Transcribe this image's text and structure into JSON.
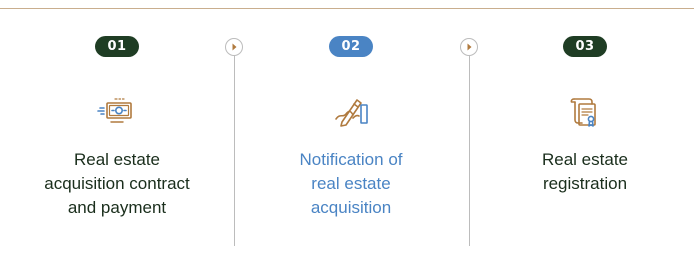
{
  "colors": {
    "accent_gold": "#b07a3e",
    "rule": "#c9ae8e",
    "divider": "#bcbcbc",
    "text_default": "#1a2e1c",
    "text_active": "#4a84c4",
    "badge_default": "#1f3d24",
    "badge_active": "#4a84c4"
  },
  "steps": [
    {
      "number": "01",
      "label": "Real estate\nacquisition contract\nand payment",
      "icon": "money-payment-icon",
      "active": false
    },
    {
      "number": "02",
      "label": "Notification of\nreal estate\nacquisition",
      "icon": "signature-pen-icon",
      "active": true
    },
    {
      "number": "03",
      "label": "Real estate\nregistration",
      "icon": "certificate-document-icon",
      "active": false
    }
  ],
  "connectors": [
    {
      "icon": "chevron-right-icon"
    },
    {
      "icon": "chevron-right-icon"
    }
  ]
}
